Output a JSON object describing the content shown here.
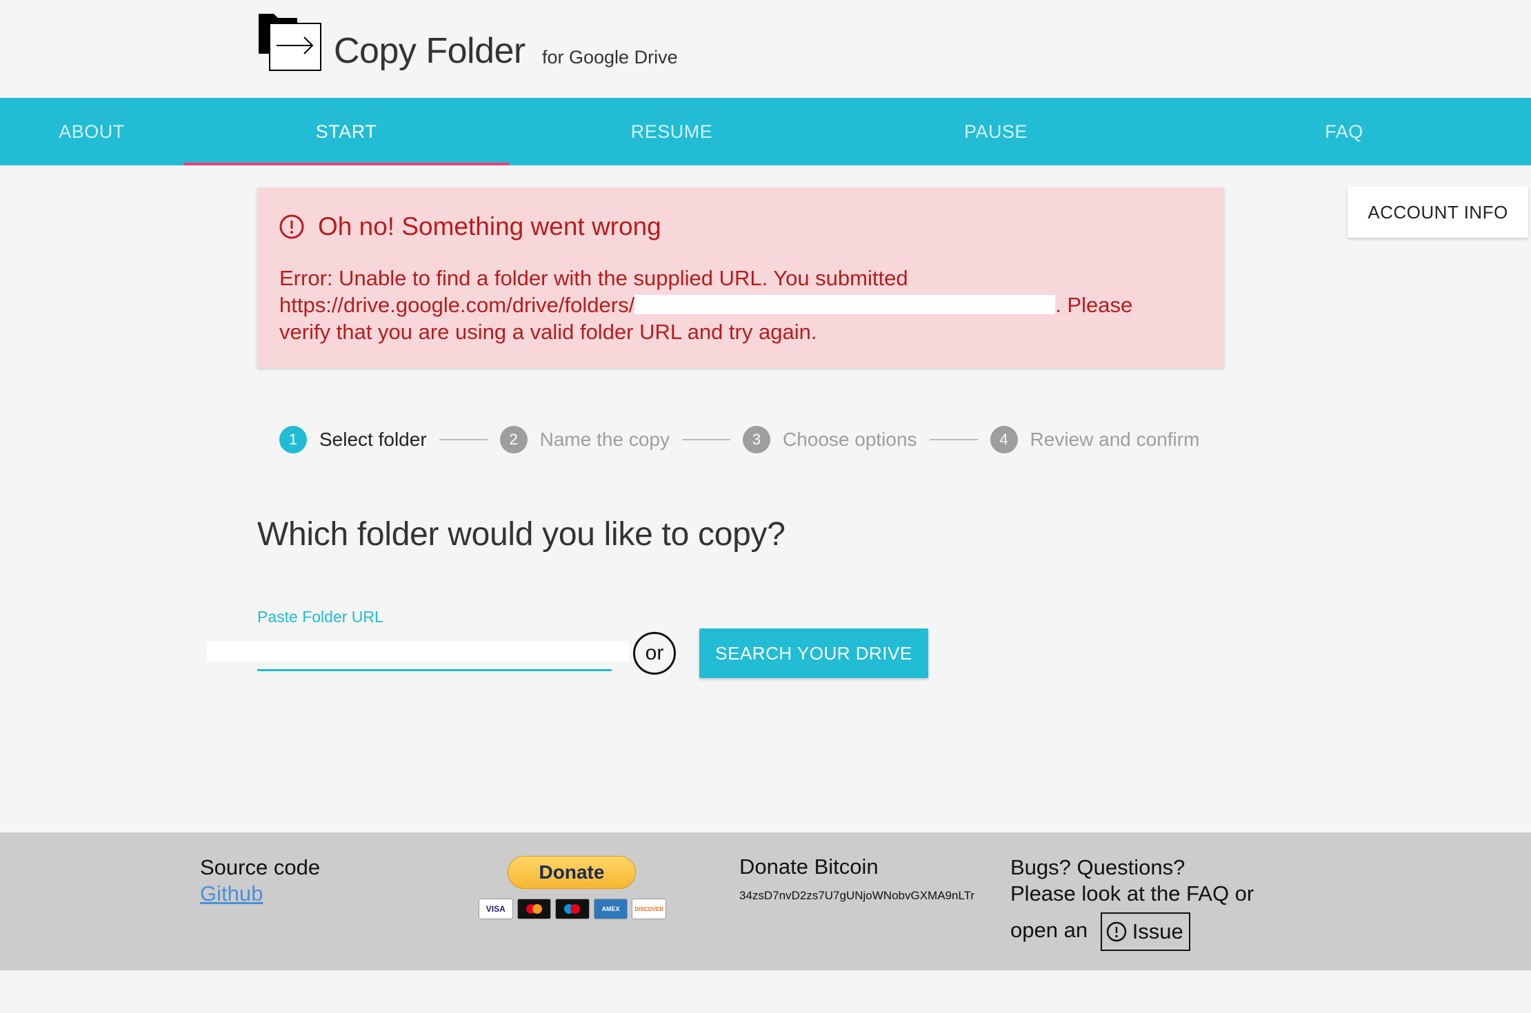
{
  "app": {
    "title": "Copy Folder",
    "subtitle": "for Google Drive"
  },
  "nav": {
    "tabs": [
      {
        "label": "ABOUT"
      },
      {
        "label": "START"
      },
      {
        "label": "RESUME"
      },
      {
        "label": "PAUSE"
      },
      {
        "label": "FAQ"
      }
    ],
    "active": "START"
  },
  "account": {
    "label": "ACCOUNT INFO"
  },
  "error": {
    "title": "Oh no! Something went wrong",
    "line1": "Error: Unable to find a folder with the supplied URL. You submitted",
    "url_prefix": "https://drive.google.com/drive/folders/",
    "line2_suffix": ". Please",
    "line3": "verify that you are using a valid folder URL and try again.",
    "icon": "alert-circle-icon",
    "color": "#b71c1c",
    "background": "#f8d7da"
  },
  "stepper": {
    "steps": [
      {
        "num": "1",
        "label": "Select folder"
      },
      {
        "num": "2",
        "label": "Name the copy"
      },
      {
        "num": "3",
        "label": "Choose options"
      },
      {
        "num": "4",
        "label": "Review and confirm"
      }
    ],
    "active_index": 0
  },
  "main": {
    "question": "Which folder would you like to copy?",
    "url_label": "Paste Folder URL",
    "url_value": "",
    "or_text": "or",
    "search_button": "SEARCH YOUR DRIVE"
  },
  "footer": {
    "source_title": "Source code",
    "source_link": "Github",
    "donate_button": "Donate",
    "cards": [
      "VISA",
      "mastercard",
      "maestro",
      "AMERICAN EXPRESS",
      "DISCOVER"
    ],
    "btc_title": "Donate Bitcoin",
    "btc_address": "34zsD7nvD2zs7U7gUNjoWNobvGXMA9nLTr",
    "bugs_title": "Bugs? Questions?",
    "bugs_line1": "Please look at the FAQ or",
    "bugs_line2": "open an",
    "issue_label": "Issue"
  },
  "colors": {
    "accent": "#22bcd4",
    "tab_indicator": "#ec407a",
    "footer_bg": "#cccccc"
  }
}
